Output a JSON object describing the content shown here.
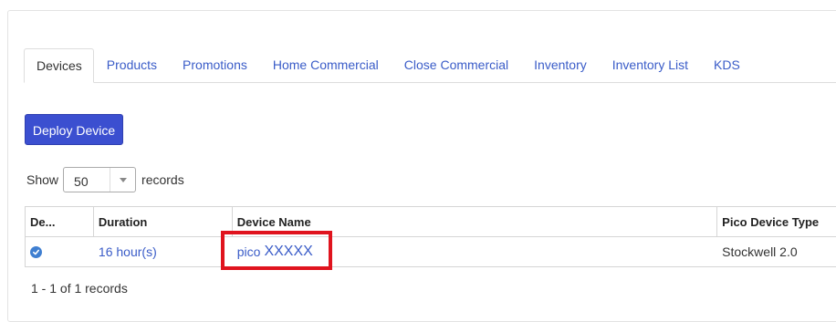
{
  "tabs": [
    {
      "label": "Devices",
      "active": true
    },
    {
      "label": "Products",
      "active": false
    },
    {
      "label": "Promotions",
      "active": false
    },
    {
      "label": "Home Commercial",
      "active": false
    },
    {
      "label": "Close Commercial",
      "active": false
    },
    {
      "label": "Inventory",
      "active": false
    },
    {
      "label": "Inventory List",
      "active": false
    },
    {
      "label": "KDS",
      "active": false
    }
  ],
  "toolbar": {
    "deploy_label": "Deploy Device"
  },
  "page_size": {
    "show_label": "Show",
    "selected": "50",
    "records_label": "records"
  },
  "table": {
    "columns": [
      "De...",
      "Duration",
      "Device Name",
      "Pico Device Type"
    ],
    "rows": [
      {
        "status_icon": "check-circle-icon",
        "duration": "16 hour(s)",
        "device_name_prefix": "pico",
        "device_name_suffix": "XXXXX",
        "device_type": "Stockwell 2.0"
      }
    ]
  },
  "footer": {
    "summary": "1 - 1 of 1 records"
  },
  "colors": {
    "accent": "#3b4fd0",
    "link": "#3a5cc8",
    "highlight": "#e0141e",
    "status_icon": "#3f7fd1"
  }
}
